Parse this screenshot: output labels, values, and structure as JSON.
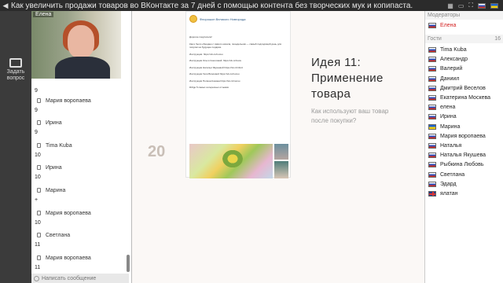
{
  "topbar": {
    "back_icon": "arrow-left-icon",
    "title": "Как увеличить продажи товаров во ВКонтакте за 7 дней с помощью контента без творческих мук и копипаста.",
    "tools": [
      "grid-icon",
      "window-icon",
      "fullscreen-icon"
    ],
    "languages": [
      "ru",
      "ua"
    ]
  },
  "leftbar": {
    "ask_label": "Задать вопрос"
  },
  "video": {
    "name": "Елена"
  },
  "chat": {
    "messages": [
      {
        "user": "",
        "text": "9"
      },
      {
        "user": "Мария воропаева",
        "text": "9"
      },
      {
        "user": "Ирина",
        "text": "9"
      },
      {
        "user": "Tima Kuba",
        "text": "10"
      },
      {
        "user": "Ирина",
        "text": "10"
      },
      {
        "user": "Марина",
        "text": "+"
      },
      {
        "user": "Мария воропаева",
        "text": "10"
      },
      {
        "user": "Светлана",
        "text": "11"
      },
      {
        "user": "Мария воропаева",
        "text": "11"
      }
    ],
    "input_placeholder": "Написать сообщение"
  },
  "slide": {
    "number": "20",
    "group_name": "Флорошоп Великого Новгорода",
    "post_lines": [
      "Дорогие покупатели!",
      "Как и было обещано с самого начала, понедельник — самый подходящий день для покупки на будущее подарка.",
      "Инструкция: https://vk.cc/nocuu",
      "Инструкция Ольги Соколовой. https://vk.cc/nocu",
      "Инструкция Натальи Якушевой https://vk.cc/nbcd",
      "Инструкция Гали Власовой https://vk.cc/nocuu",
      "Инструкция Полина Кожина https://vk.cc/nocuu",
      "#nfigo 5 самых интересных отзывов"
    ],
    "idea_title_line1": "Идея 11:",
    "idea_title_line2": "Применение",
    "idea_title_line3": "товара",
    "idea_subtitle": "Как используют ваш товар после покупки?"
  },
  "participants": {
    "moderators_label": "Модераторы",
    "moderators": [
      {
        "name": "Елена",
        "flag": "ru"
      }
    ],
    "guests_label": "Гости",
    "guests_count": "16",
    "guests": [
      {
        "name": "Tima Kuba",
        "flag": "ru"
      },
      {
        "name": "Александр",
        "flag": "ru"
      },
      {
        "name": "Валерий",
        "flag": "ru"
      },
      {
        "name": "Даниил",
        "flag": "ru"
      },
      {
        "name": "Дмитрий Веселов",
        "flag": "ru"
      },
      {
        "name": "Екатерина Москева",
        "flag": "ru"
      },
      {
        "name": "елена",
        "flag": "ru"
      },
      {
        "name": "Ирина",
        "flag": "ru"
      },
      {
        "name": "Марина",
        "flag": "ua"
      },
      {
        "name": "Мария воропаева",
        "flag": "ru"
      },
      {
        "name": "Наталья",
        "flag": "ru"
      },
      {
        "name": "Наталья Якушева",
        "flag": "ru"
      },
      {
        "name": "Рыбкина Любовь",
        "flag": "ru"
      },
      {
        "name": "Светлана",
        "flag": "ru"
      },
      {
        "name": "Эдард",
        "flag": "ru"
      },
      {
        "name": "ялатан",
        "flag": "gb"
      }
    ]
  }
}
